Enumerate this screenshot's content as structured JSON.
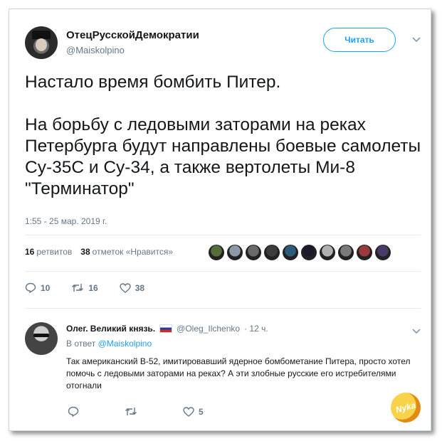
{
  "tweet": {
    "author_name": "ОтецРусскойДемократии",
    "author_handle": "@Maiskolpino",
    "follow_label": "Читать",
    "paragraphs": [
      "Настало время бомбить Питер.",
      "На борьбу с ледовыми заторами на реках Петербурга будут направлены боевые самолеты Су-35С и Су-34, а также вертолеты Ми-8 \"Терминатор\""
    ],
    "timestamp": "1:55 - 25 мар. 2019 г.",
    "retweets_count": "16",
    "retweets_label": "ретвитов",
    "likes_count": "38",
    "likes_label": "отметок «Нравится»",
    "liker_colors": [
      "#5a6b3c",
      "#8d99a6",
      "#6a6a6a",
      "#3d3d3d",
      "#2d5b7a",
      "#1a1a2a",
      "#b0b0b0",
      "#7a7a7a",
      "#9b3a3a",
      "#4a3a6a"
    ],
    "actions": {
      "replies": "10",
      "retweets": "16",
      "likes": "38"
    }
  },
  "reply": {
    "author_name": "Олег. Великий князь.",
    "author_handle": "@Oleg_Ilchenko",
    "time": "· 12 ч.",
    "reply_to_prefix": "В ответ",
    "reply_to_handle": "@Maiskolpino",
    "text": "Так американский B-52, имитировавший ядерное бомбометание Питера, просто хотел помочь с ледовыми заторами на реках? А эти злобные русские его истребителями отогнали",
    "actions": {
      "replies": "",
      "retweets": "",
      "likes": "5"
    }
  },
  "watermark": "Nyka",
  "colors": {
    "accent": "#1da1f2",
    "muted": "#657786",
    "text": "#14171a",
    "divider": "#e6ecf0"
  }
}
